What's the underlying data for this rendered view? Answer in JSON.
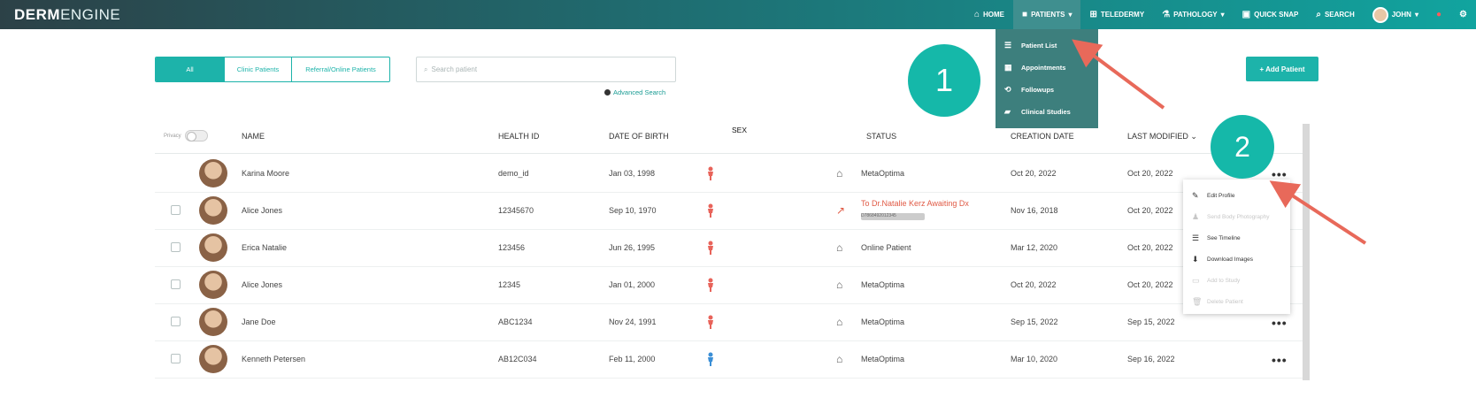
{
  "app": {
    "logo_bold": "DERM",
    "logo_light": "ENGINE"
  },
  "nav": {
    "items": [
      {
        "label": "HOME",
        "icon": "home-icon",
        "glyph": "⌂"
      },
      {
        "label": "PATIENTS",
        "icon": "patients-icon",
        "glyph": "■",
        "caret": "▾"
      },
      {
        "label": "TELEDERMY",
        "icon": "teledermy-icon",
        "glyph": "⊞"
      },
      {
        "label": "PATHOLOGY",
        "icon": "pathology-icon",
        "glyph": "⚗",
        "caret": "▾"
      },
      {
        "label": "QUICK SNAP",
        "icon": "camera-icon",
        "glyph": "▣"
      },
      {
        "label": "SEARCH",
        "icon": "search-icon",
        "glyph": "⌕"
      },
      {
        "label": "JOHN",
        "icon": "avatar",
        "caret": "▾"
      },
      {
        "label": "",
        "icon": "notification-icon",
        "glyph": "●"
      },
      {
        "label": "",
        "icon": "settings-icon",
        "glyph": "⚙"
      }
    ],
    "patients_dropdown": [
      {
        "label": "Patient List",
        "icon": "list-icon",
        "glyph": "☰"
      },
      {
        "label": "Appointments",
        "icon": "calendar-icon",
        "glyph": "▦"
      },
      {
        "label": "Followups",
        "icon": "followup-icon",
        "glyph": "⟲"
      },
      {
        "label": "Clinical Studies",
        "icon": "folder-icon",
        "glyph": "▰"
      }
    ]
  },
  "filters": {
    "tabs": [
      "All",
      "Clinic Patients",
      "Referral/Online Patients"
    ],
    "active_tab": "All",
    "search_placeholder": "Search patient",
    "advanced_search": "Advanced Search",
    "add_button": "+ Add Patient"
  },
  "steps": {
    "one": "1",
    "two": "2"
  },
  "table": {
    "privacy_label": "Privacy",
    "columns": {
      "name": "NAME",
      "health_id": "HEALTH ID",
      "dob": "DATE OF BIRTH",
      "sex": "SEX",
      "status": "STATUS",
      "created": "CREATION DATE",
      "modified": "LAST MODIFIED"
    },
    "rows": [
      {
        "name": "Karina Moore",
        "health_id": "demo_id",
        "dob": "Jan 03, 1998",
        "sex": "female",
        "status": "MetaOptima",
        "status_type": "clinic",
        "created": "Oct 20, 2022",
        "modified": "Oct 20, 2022"
      },
      {
        "name": "Alice Jones",
        "health_id": "12345670",
        "dob": "Sep 10, 1970",
        "sex": "female",
        "status": "To Dr.Natalie Kerz Awaiting Dx",
        "status_sub": "D7868492012345",
        "status_type": "referral",
        "created": "Nov 16, 2018",
        "modified": "Oct 20, 2022"
      },
      {
        "name": "Erica Natalie",
        "health_id": "123456",
        "dob": "Jun 26, 1995",
        "sex": "female",
        "status": "Online Patient",
        "status_type": "clinic",
        "created": "Mar 12, 2020",
        "modified": "Oct 20, 2022"
      },
      {
        "name": "Alice Jones",
        "health_id": "12345",
        "dob": "Jan 01, 2000",
        "sex": "female",
        "status": "MetaOptima",
        "status_type": "clinic",
        "created": "Oct 20, 2022",
        "modified": "Oct 20, 2022"
      },
      {
        "name": "Jane Doe",
        "health_id": "ABC1234",
        "dob": "Nov 24, 1991",
        "sex": "female",
        "status": "MetaOptima",
        "status_type": "clinic",
        "created": "Sep 15, 2022",
        "modified": "Sep 15, 2022"
      },
      {
        "name": "Kenneth Petersen",
        "health_id": "AB12C034",
        "dob": "Feb 11, 2000",
        "sex": "male",
        "status": "MetaOptima",
        "status_type": "clinic",
        "created": "Mar 10, 2020",
        "modified": "Sep 16, 2022"
      }
    ],
    "row_menu": [
      {
        "label": "Edit Profile",
        "icon": "edit-icon",
        "glyph": "✎",
        "disabled": false
      },
      {
        "label": "Send Body Photography",
        "icon": "body-icon",
        "glyph": "♟",
        "disabled": true
      },
      {
        "label": "See Timeline",
        "icon": "timeline-icon",
        "glyph": "☰",
        "disabled": false
      },
      {
        "label": "Download Images",
        "icon": "download-icon",
        "glyph": "⬇",
        "disabled": false
      },
      {
        "label": "Add to Study",
        "icon": "study-icon",
        "glyph": "▭",
        "disabled": true
      },
      {
        "label": "Delete Patient",
        "icon": "trash-icon",
        "glyph": "🗑",
        "disabled": true
      }
    ]
  },
  "colors": {
    "accent": "#1db3aa",
    "arrow": "#e8695a",
    "female": "#e8635a",
    "male": "#3b8fd6",
    "referral": "#e05a45"
  }
}
